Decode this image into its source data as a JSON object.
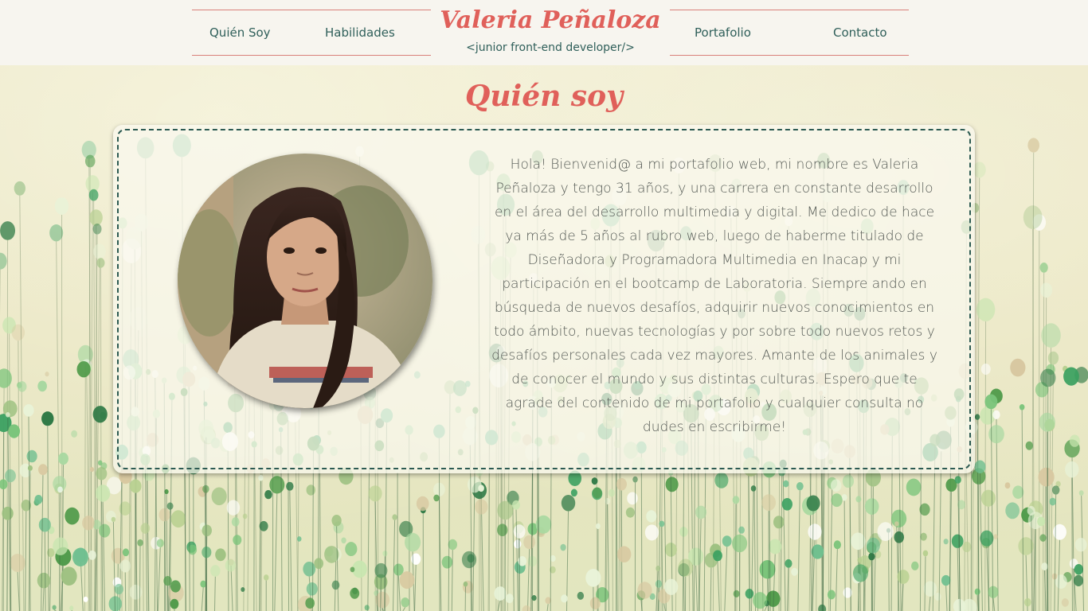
{
  "header": {
    "brand_name": "Valeria Peñaloza",
    "brand_tagline": "<junior front-end developer/>",
    "nav": [
      "Quién Soy",
      "Habilidades",
      "Portafolio",
      "Contacto"
    ]
  },
  "about": {
    "title": "Quién soy",
    "bio": "Hola! Bienvenid@ a mi portafolio web, mi nombre es Valeria Peñaloza y tengo 31 años, y una carrera en constante desarrollo en el área del desarrollo multimedia y digital. Me dedico de hace ya más de 5 años al rubro web, luego de haberme titulado de Diseñadora y Programadora Multimedia en Inacap y mi participación en el bootcamp de Laboratoria. Siempre ando en búsqueda de nuevos desafíos, adquirir nuevos conocimientos en todo ámbito, nuevas tecnologías y por sobre todo nuevos retos y desafíos personales cada vez mayores. Amante de los animales y de conocer el mundo y sus distintas culturas. Espero que te agrade del contenido de mi portafolio y cualquier consulta no dudes en escribirme!",
    "photo_icon": "profile-photo"
  },
  "colors": {
    "accent": "#e0605a",
    "text_dark": "#2f5f5a",
    "border": "#2c5a52",
    "header_bg": "#f7f5ef"
  }
}
